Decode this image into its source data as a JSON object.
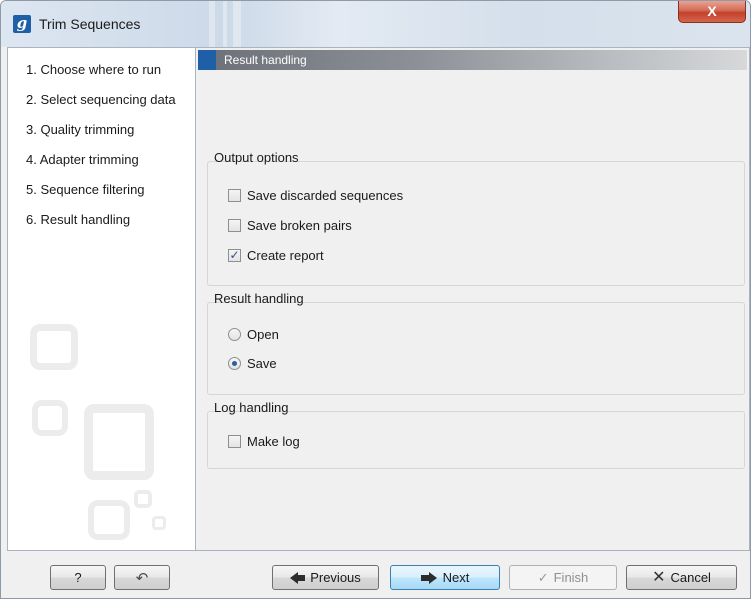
{
  "window": {
    "title": "Trim Sequences",
    "app_icon_glyph": "g",
    "close_glyph": "X"
  },
  "sidebar": {
    "steps": [
      {
        "label": "1.  Choose where to run"
      },
      {
        "label": "2.  Select sequencing data"
      },
      {
        "label": "3.  Quality trimming"
      },
      {
        "label": "4.  Adapter trimming"
      },
      {
        "label": "5.  Sequence filtering"
      },
      {
        "label": "6.  Result handling"
      }
    ]
  },
  "content": {
    "header": "Result handling",
    "output_options": {
      "title": "Output options",
      "items": [
        {
          "label": "Save discarded sequences",
          "checked": false
        },
        {
          "label": "Save broken pairs",
          "checked": false
        },
        {
          "label": "Create report",
          "checked": true
        }
      ]
    },
    "result_handling": {
      "title": "Result handling",
      "options": [
        {
          "label": "Open",
          "selected": false
        },
        {
          "label": "Save",
          "selected": true
        }
      ]
    },
    "log_handling": {
      "title": "Log handling",
      "items": [
        {
          "label": "Make log",
          "checked": false
        }
      ]
    }
  },
  "footer": {
    "help_label": "?",
    "previous_label": "Previous",
    "next_label": "Next",
    "finish_label": "Finish",
    "cancel_label": "Cancel"
  },
  "icons": {
    "app": "app-logo-icon",
    "close": "close-icon",
    "reset": "reset-arrow-icon",
    "previous": "arrow-left-icon",
    "next": "arrow-right-icon",
    "finish": "checkmark-icon",
    "cancel": "x-icon"
  }
}
